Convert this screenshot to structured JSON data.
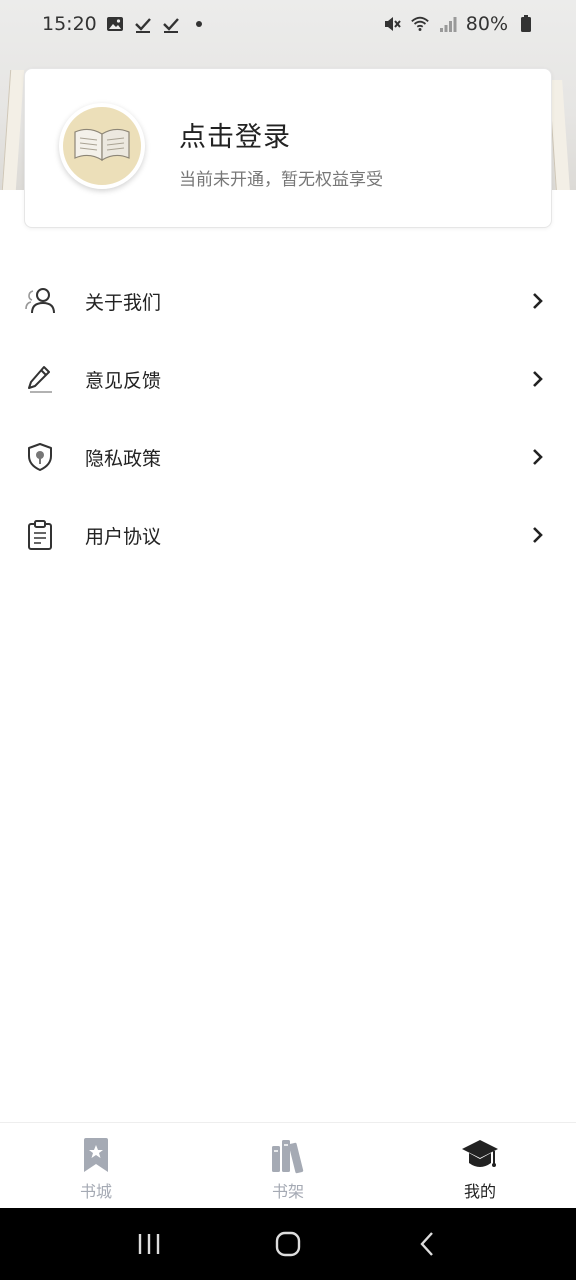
{
  "status_bar": {
    "time": "15:20",
    "battery": "80%",
    "left_icons": [
      "image-icon",
      "check-icon",
      "check-icon",
      "dot-icon"
    ],
    "right_icons": [
      "mute-icon",
      "wifi-icon",
      "signal-icon",
      "battery-icon"
    ]
  },
  "profile": {
    "title": "点击登录",
    "subtitle": "当前未开通，暂无权益享受",
    "avatar_icon": "book-icon"
  },
  "menu": {
    "items": [
      {
        "label": "关于我们",
        "icon": "users-icon"
      },
      {
        "label": "意见反馈",
        "icon": "pencil-icon"
      },
      {
        "label": "隐私政策",
        "icon": "shield-icon"
      },
      {
        "label": "用户协议",
        "icon": "clipboard-icon"
      }
    ]
  },
  "bottom_nav": {
    "items": [
      {
        "label": "书城",
        "icon": "bookmark-star-icon",
        "active": false
      },
      {
        "label": "书架",
        "icon": "bookshelf-icon",
        "active": false
      },
      {
        "label": "我的",
        "icon": "graduation-cap-icon",
        "active": true
      }
    ]
  },
  "colors": {
    "active": "#222222",
    "inactive": "#a5aab4",
    "header_bg": "#e6e5e3",
    "system_nav": "#000000"
  }
}
